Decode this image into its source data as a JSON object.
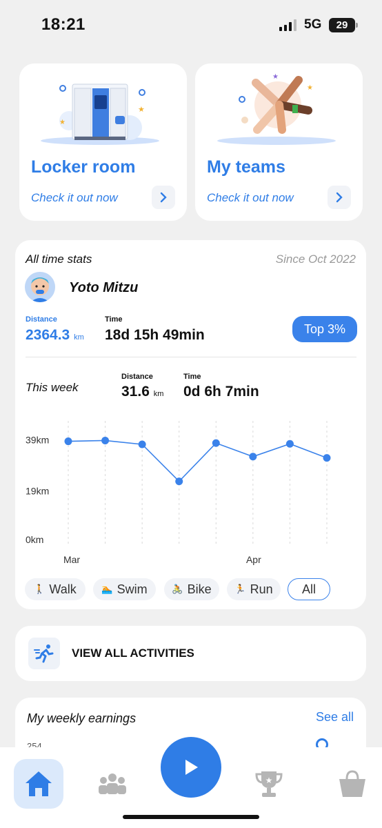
{
  "status_bar": {
    "time": "18:21",
    "network": "5G",
    "battery": "29"
  },
  "cards": [
    {
      "title": "Locker room",
      "subtitle": "Check it out now",
      "icon": "locker-illustration"
    },
    {
      "title": "My teams",
      "subtitle": "Check it out now",
      "icon": "team-hands-illustration"
    }
  ],
  "stats": {
    "heading": "All time stats",
    "since": "Since Oct 2022",
    "user_name": "Yoto Mitzu",
    "alltime": {
      "distance_label": "Distance",
      "distance_value": "2364.3",
      "distance_unit": "km",
      "time_label": "Time",
      "time_value": "18d 15h 49min"
    },
    "rank_badge": "Top 3%",
    "week": {
      "label": "This week",
      "distance_label": "Distance",
      "distance_value": "31.6",
      "distance_unit": "km",
      "time_label": "Time",
      "time_value": "0d 6h 7min"
    }
  },
  "chart_data": {
    "type": "line",
    "x_labels": [
      "Mar",
      "Apr"
    ],
    "y_ticks": [
      "39km",
      "19km",
      "0km"
    ],
    "ylim": [
      0,
      40
    ],
    "values": [
      38.5,
      38.8,
      37.3,
      22.8,
      37.8,
      32.5,
      37.5,
      32.0
    ],
    "color": "#3a82ea",
    "grid": "vertical-dashed"
  },
  "filters": [
    {
      "label": "Walk",
      "icon": "walk-icon"
    },
    {
      "label": "Swim",
      "icon": "swim-icon"
    },
    {
      "label": "Bike",
      "icon": "bike-icon"
    },
    {
      "label": "Run",
      "icon": "run-icon"
    },
    {
      "label": "All",
      "icon": "",
      "active": true
    }
  ],
  "activities": {
    "label": "VIEW ALL ACTIVITIES",
    "icon": "running-person-icon"
  },
  "earnings": {
    "title": "My weekly earnings",
    "see_all": "See all",
    "y_tick": "254"
  },
  "nav": {
    "items": [
      "home-icon",
      "teams-icon",
      "play-icon",
      "trophy-icon",
      "shop-bag-icon"
    ],
    "active": "home-icon"
  },
  "colors": {
    "accent": "#2f7de6",
    "background": "#f0f0f0"
  }
}
